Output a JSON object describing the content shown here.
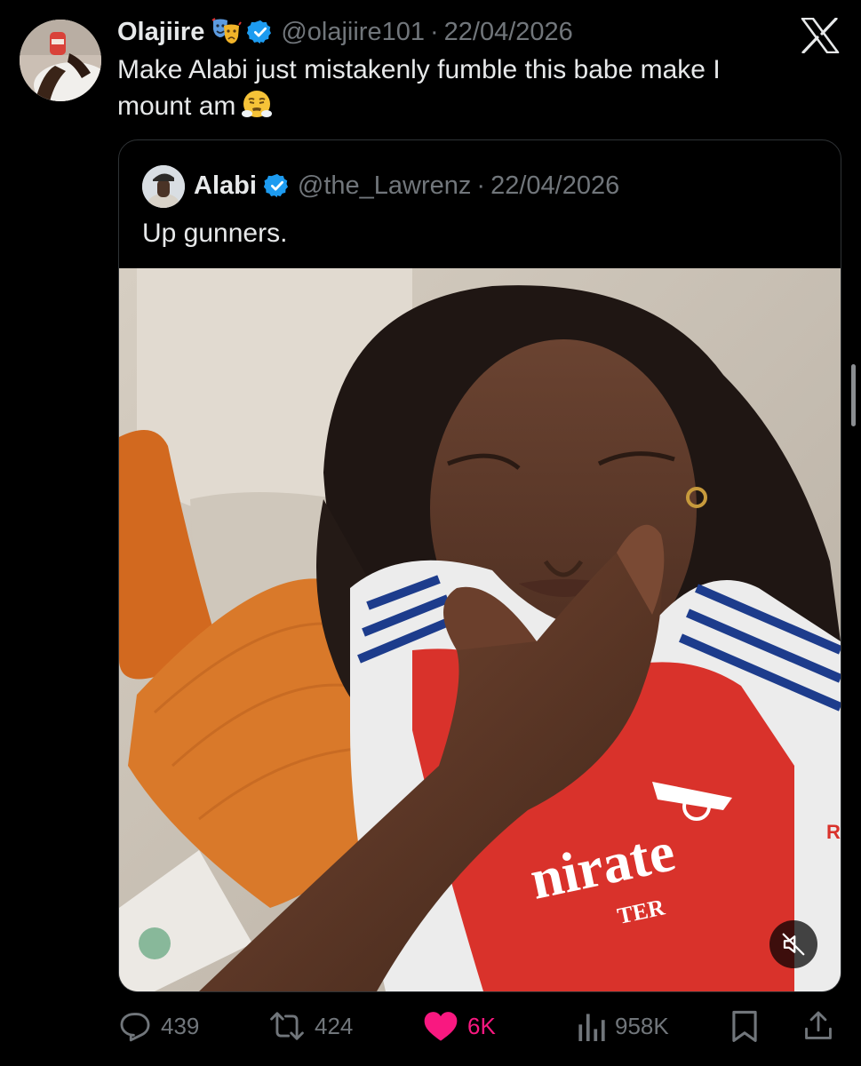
{
  "post": {
    "display_name": "Olajiire",
    "name_emoji_icon": "performing-arts-emoji-icon",
    "handle": "@olajiire101",
    "separator": "·",
    "date": "22/04/2026",
    "text": "Make Alabi just mistakenly fumble this babe make I mount am",
    "text_emoji_icon": "face-with-steam-emoji-icon",
    "verified": true
  },
  "quoted_post": {
    "display_name": "Alabi",
    "handle": "@the_Lawrenz",
    "separator": "·",
    "date": "22/04/2026",
    "text": "Up gunners.",
    "verified": true,
    "media": {
      "type": "video",
      "muted": true,
      "jersey_text_1": "nirate",
      "jersey_text_2": "TER",
      "jersey_side_letter": "R"
    }
  },
  "actions": {
    "replies": "439",
    "reposts": "424",
    "likes": "6K",
    "views": "958K"
  },
  "colors": {
    "background": "#000000",
    "text_primary": "#e7e9ea",
    "text_secondary": "#71767b",
    "verified_blue": "#1d9bf0",
    "like_pink": "#f91880",
    "border": "#2f3336"
  }
}
